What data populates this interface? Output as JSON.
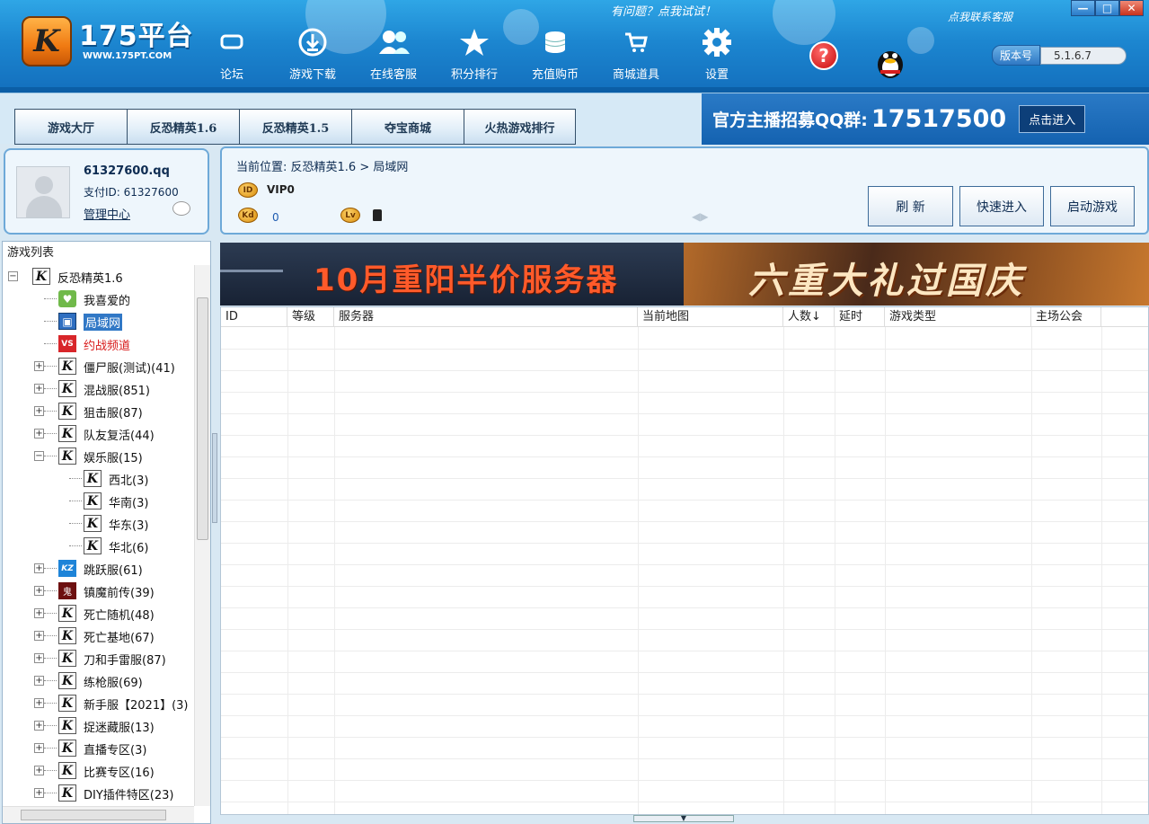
{
  "window": {
    "hint_question": "有问题？点我试试！",
    "hint_contact": "点我联系客服",
    "buttons": {
      "minimize": "—",
      "maximize": "□",
      "close": "✕"
    }
  },
  "logo": {
    "title": "175平台",
    "sub": "WWW.175PT.COM"
  },
  "nav": [
    {
      "label": "论坛",
      "icon": "forum-icon"
    },
    {
      "label": "游戏下载",
      "icon": "download-icon"
    },
    {
      "label": "在线客服",
      "icon": "online-service-icon"
    },
    {
      "label": "积分排行",
      "icon": "ranking-star-icon"
    },
    {
      "label": "充值购币",
      "icon": "coins-icon"
    },
    {
      "label": "商城道具",
      "icon": "shop-cart-icon"
    },
    {
      "label": "设置",
      "icon": "gear-icon"
    }
  ],
  "version": {
    "label": "版本号",
    "value": "5.1.6.7"
  },
  "tabs": [
    "游戏大厅",
    "反恐精英1.6",
    "反恐精英1.5",
    "夺宝商城",
    "火热游戏排行"
  ],
  "promo": {
    "text": "官方主播招募QQ群:",
    "number": "17517500",
    "button": "点击进入"
  },
  "user": {
    "name": "61327600.qq",
    "pay_id": "支付ID: 61327600",
    "manage": "管理中心"
  },
  "info": {
    "breadcrumb": "当前位置: 反恐精英1.6 > 局域网",
    "vip": "VIP0",
    "kd_value": "0",
    "id_badge": "ID",
    "kd_badge": "Kd",
    "lv_badge": "Lv",
    "buttons": {
      "refresh": "刷    新",
      "quick": "快速进入",
      "start": "启动游戏"
    }
  },
  "banner": {
    "left": "10月重阳半价服务器",
    "right": "六重大礼过国庆"
  },
  "tree": {
    "title": "游戏列表",
    "nodes": [
      {
        "label": "反恐精英1.6",
        "level": 0,
        "toggle": "-",
        "icon": "cs"
      },
      {
        "label": "我喜爱的",
        "level": 1,
        "toggle": "",
        "icon": "fav"
      },
      {
        "label": "局域网",
        "level": 1,
        "toggle": "",
        "icon": "lan",
        "selected": true
      },
      {
        "label": "约战频道",
        "level": 1,
        "toggle": "",
        "icon": "vs",
        "red": true
      },
      {
        "label": "僵尸服(测试)(41)",
        "level": 1,
        "toggle": "+",
        "icon": "cs"
      },
      {
        "label": "混战服(851)",
        "level": 1,
        "toggle": "+",
        "icon": "cs"
      },
      {
        "label": "狙击服(87)",
        "level": 1,
        "toggle": "+",
        "icon": "cs"
      },
      {
        "label": "队友复活(44)",
        "level": 1,
        "toggle": "+",
        "icon": "cs"
      },
      {
        "label": "娱乐服(15)",
        "level": 1,
        "toggle": "-",
        "icon": "cs"
      },
      {
        "label": "西北(3)",
        "level": 2,
        "toggle": "",
        "icon": "cs"
      },
      {
        "label": "华南(3)",
        "level": 2,
        "toggle": "",
        "icon": "cs"
      },
      {
        "label": "华东(3)",
        "level": 2,
        "toggle": "",
        "icon": "cs"
      },
      {
        "label": "华北(6)",
        "level": 2,
        "toggle": "",
        "icon": "cs"
      },
      {
        "label": "跳跃服(61)",
        "level": 1,
        "toggle": "+",
        "icon": "kz"
      },
      {
        "label": "镇魔前传(39)",
        "level": 1,
        "toggle": "+",
        "icon": "zm"
      },
      {
        "label": "死亡随机(48)",
        "level": 1,
        "toggle": "+",
        "icon": "cs"
      },
      {
        "label": "死亡基地(67)",
        "level": 1,
        "toggle": "+",
        "icon": "cs"
      },
      {
        "label": "刀和手雷服(87)",
        "level": 1,
        "toggle": "+",
        "icon": "cs"
      },
      {
        "label": "练枪服(69)",
        "level": 1,
        "toggle": "+",
        "icon": "cs"
      },
      {
        "label": "新手服【2021】(3)",
        "level": 1,
        "toggle": "+",
        "icon": "cs"
      },
      {
        "label": "捉迷藏服(13)",
        "level": 1,
        "toggle": "+",
        "icon": "cs"
      },
      {
        "label": "直播专区(3)",
        "level": 1,
        "toggle": "+",
        "icon": "cs"
      },
      {
        "label": "比赛专区(16)",
        "level": 1,
        "toggle": "+",
        "icon": "cs"
      },
      {
        "label": "DIY插件特区(23)",
        "level": 1,
        "toggle": "+",
        "icon": "cs"
      }
    ]
  },
  "table": {
    "columns": [
      "ID",
      "等级",
      "服务器",
      "当前地图",
      "人数↓",
      "延时",
      "游戏类型",
      "主场公会"
    ]
  }
}
